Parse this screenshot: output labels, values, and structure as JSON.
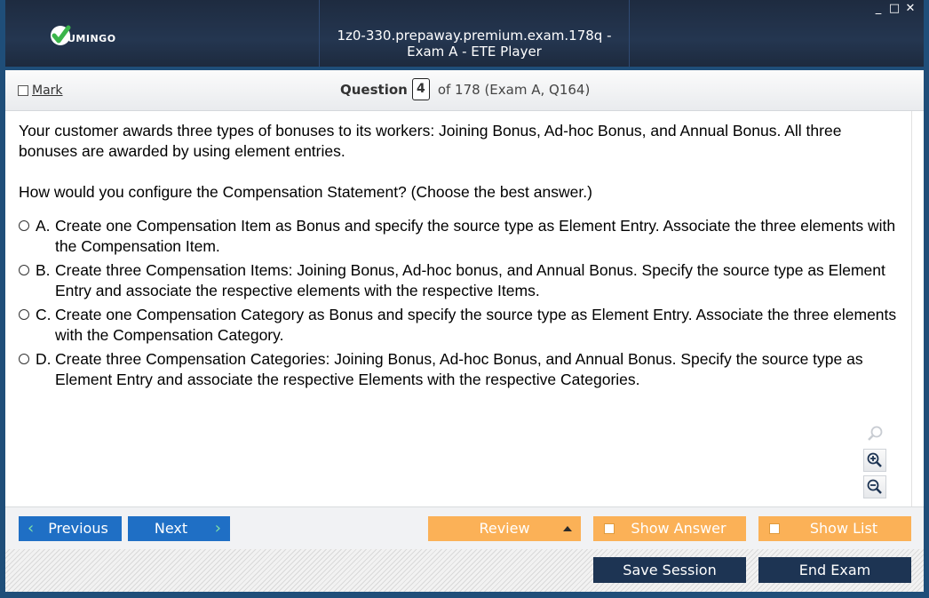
{
  "window": {
    "title": "1z0-330.prepaway.premium.exam.178q - Exam A - ETE Player",
    "logo_text": "UMINGO",
    "controls": {
      "minimize": "_",
      "maximize": "□",
      "close": "✕"
    }
  },
  "question_header": {
    "mark_label": "Mark",
    "question_label": "Question",
    "question_number": "4",
    "of_text": "of 178 (Exam A, Q164)"
  },
  "question": {
    "paragraph1": "Your customer awards three types of bonuses to its workers: Joining Bonus, Ad-hoc Bonus, and Annual Bonus. All three bonuses are awarded by using element entries.",
    "paragraph2": "How would you configure the Compensation Statement? (Choose the best answer.)",
    "options": [
      {
        "letter": "A.",
        "text": "Create one Compensation Item as Bonus and specify the source type as Element Entry. Associate the three elements with the Compensation Item."
      },
      {
        "letter": "B.",
        "text": "Create three Compensation Items: Joining Bonus, Ad-hoc bonus, and Annual Bonus. Specify the source type as Element Entry and associate the respective elements with the respective Items."
      },
      {
        "letter": "C.",
        "text": "Create one Compensation Category as Bonus and specify the source type as Element Entry. Associate the three elements with the Compensation Category."
      },
      {
        "letter": "D.",
        "text": "Create three Compensation Categories: Joining Bonus, Ad-hoc Bonus, and Annual Bonus. Specify the source type as Element Entry and associate the respective Elements with the respective Categories."
      }
    ]
  },
  "zoom": {
    "icons": [
      "zoom-reset-icon",
      "zoom-in-icon",
      "zoom-out-icon"
    ]
  },
  "nav": {
    "previous_label": "Previous",
    "next_label": "Next",
    "review_label": "Review",
    "show_answer_label": "Show Answer",
    "show_list_label": "Show List"
  },
  "footer": {
    "save_label": "Save Session",
    "end_label": "End Exam"
  },
  "colors": {
    "title_bar": "#1e2b40",
    "nav_blue": "#1f6fc5",
    "nav_orange": "#fbb157",
    "dark_button": "#1d3453",
    "logo_green": "#3ab54a"
  }
}
